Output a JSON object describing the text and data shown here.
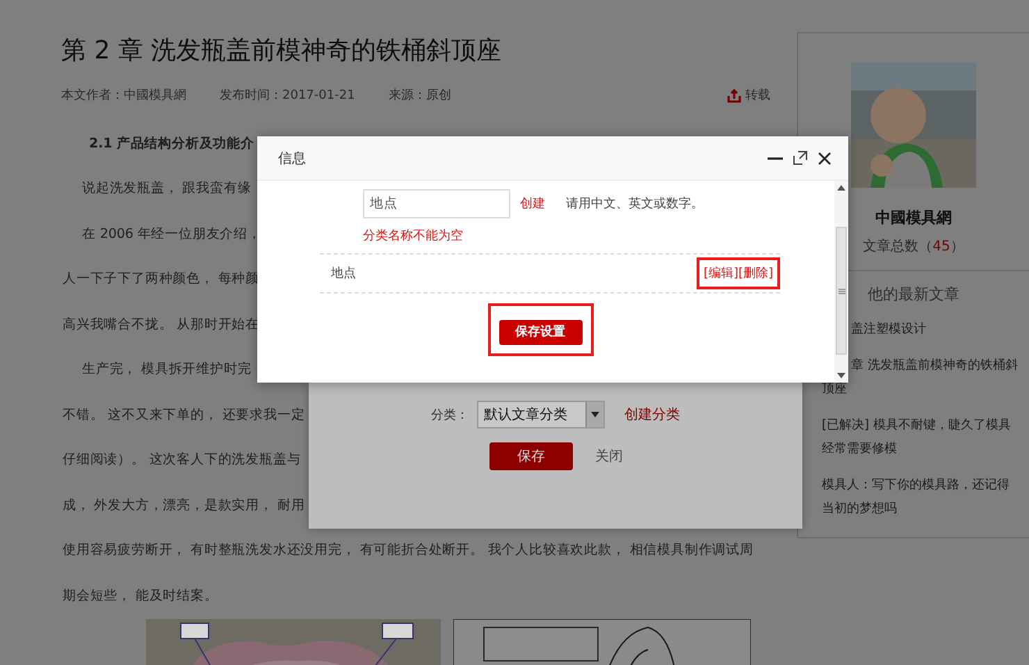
{
  "article": {
    "title": "第 2 章 洗发瓶盖前模神奇的铁桶斜顶座",
    "meta": [
      "本文作者：中國模具網",
      "发布时间：2017-01-21",
      "来源：原创"
    ],
    "repost": "转载",
    "lines": [
      {
        "kind": "heading",
        "text": "2.1 产品结构分析及功能介"
      },
      {
        "kind": "indented",
        "text": "说起洗发瓶盖， 跟我蛮有缘"
      },
      {
        "kind": "indented",
        "text": "在 2006 年经一位朋友介绍，"
      },
      {
        "kind": "plain",
        "text": "人一下子下了两种颜色， 每种颜"
      },
      {
        "kind": "plain",
        "text": "高兴我嘴合不拢。 从那时开始在"
      },
      {
        "kind": "indented",
        "text": "生产完， 模具拆开维护时完"
      },
      {
        "kind": "plain",
        "text": "不错。 这不又来下单的， 还要求我一定"
      },
      {
        "kind": "plain",
        "text": "仔细阅读）。 这次客人下的洗发瓶盖与"
      },
      {
        "kind": "plain",
        "text": "成， 外发大方，漂亮，是款实用， 耐用"
      },
      {
        "kind": "plain",
        "text": "使用容易疲劳断开， 有时整瓶洗发水还没用完， 有可能折合处断开。 我个人比较喜欢此款， 相信模具制作调试周"
      },
      {
        "kind": "plain",
        "text": "期会短些， 能及时结案。"
      }
    ]
  },
  "sidebar": {
    "author": "中國模具網",
    "count_label": "文章总数（",
    "count": "45",
    "count_end": "）",
    "recent_title": "他的最新文章",
    "recent": [
      {
        "text": "盖注塑模设计",
        "clipped": true
      },
      {
        "text": "章 洗发瓶盖前模神奇的铁桶斜顶座",
        "clipped": true
      },
      {
        "text": "[已解决] 模具不耐键，睫久了模具经常需要修模",
        "clipped": false
      },
      {
        "text": "模具人：写下你的模具路，还记得当初的梦想吗",
        "clipped": false
      }
    ]
  },
  "category_dialog": {
    "label": "分类：",
    "select_value": "默认文章分类",
    "create_link": "创建分类",
    "save": "保存",
    "close": "关闭"
  },
  "info_dialog": {
    "title": "信息",
    "name_value": "地点",
    "create_link": "创建",
    "hint": "请用中文、英文或数字。",
    "error": "分类名称不能为空",
    "categories": [
      {
        "name": "地点",
        "edit": "[编辑]",
        "delete": "[删除]",
        "highlighted": true
      }
    ],
    "save": {
      "label": "保存设置",
      "highlighted": true
    }
  }
}
